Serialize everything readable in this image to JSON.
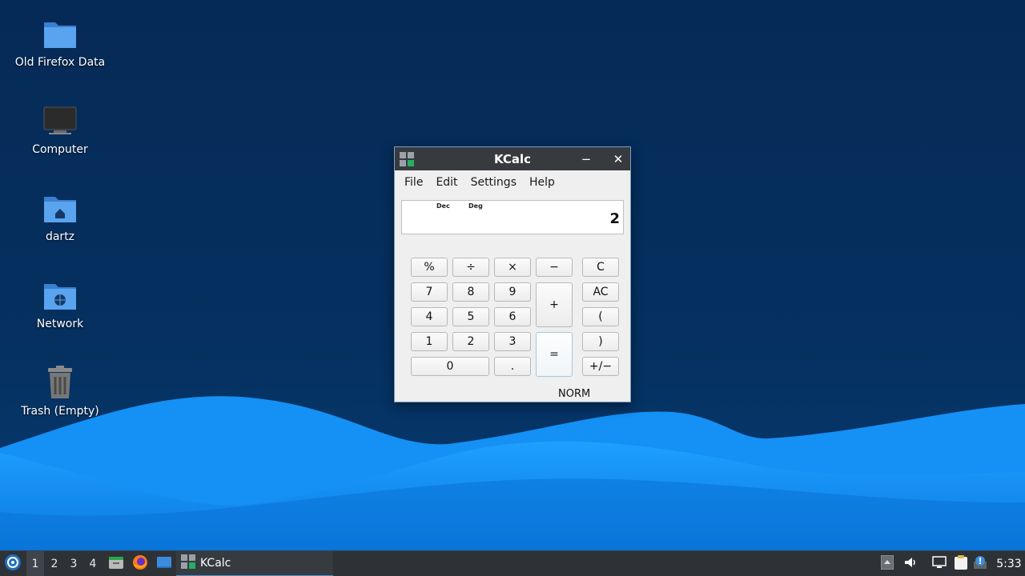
{
  "desktop": {
    "icons": [
      {
        "label": "Old Firefox Data",
        "icon": "folder-icon"
      },
      {
        "label": "Computer",
        "icon": "computer-icon"
      },
      {
        "label": "dartz",
        "icon": "home-folder-icon"
      },
      {
        "label": "Network",
        "icon": "network-folder-icon"
      },
      {
        "label": "Trash (Empty)",
        "icon": "trash-icon"
      }
    ]
  },
  "window": {
    "title": "KCalc",
    "menu": [
      "File",
      "Edit",
      "Settings",
      "Help"
    ],
    "display": {
      "base": "Dec",
      "angle": "Deg",
      "value": "2"
    },
    "keys": {
      "percent": "%",
      "divide": "÷",
      "multiply": "×",
      "minus": "−",
      "clear": "C",
      "seven": "7",
      "eight": "8",
      "nine": "9",
      "plus": "+",
      "all_clear": "AC",
      "four": "4",
      "five": "5",
      "six": "6",
      "paren_open": "(",
      "one": "1",
      "two": "2",
      "three": "3",
      "equals": "=",
      "paren_close": ")",
      "zero": "0",
      "decimal": ".",
      "sign": "+/−"
    },
    "mode": "NORM"
  },
  "taskbar": {
    "workspaces": [
      "1",
      "2",
      "3",
      "4"
    ],
    "active_workspace": "1",
    "launchers": [
      "file-manager-icon",
      "firefox-icon",
      "desktop-icon"
    ],
    "task_label": "KCalc",
    "tray": [
      "tray-expand-icon",
      "volume-icon",
      "network-icon",
      "clipboard-icon",
      "update-notifier-icon"
    ],
    "clock": "5:33"
  },
  "colors": {
    "desktop_bg": "#05305f",
    "wave_light": "#1e9bff",
    "wave_mid": "#0a7fe8",
    "titlebar": "#373b40",
    "taskbar": "#2e3236",
    "accent": "#4c8fd0"
  }
}
